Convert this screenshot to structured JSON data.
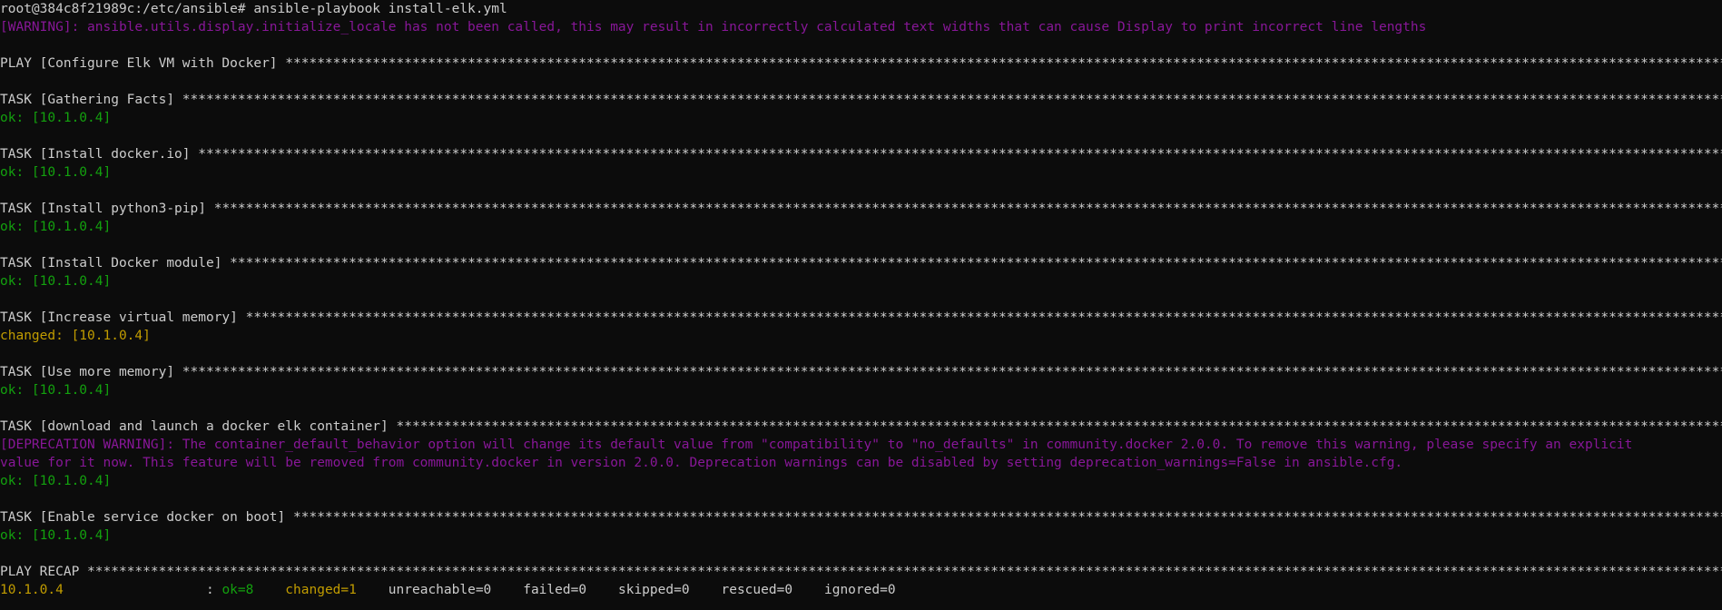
{
  "terminal": {
    "prompt": "root@384c8f21989c:/etc/ansible#",
    "command": "ansible-playbook install-elk.yml",
    "warning": "[WARNING]: ansible.utils.display.initialize_locale has not been called, this may result in incorrectly calculated text widths that can cause Display to print incorrect line lengths",
    "stars": "*****************************************************************************************************************************************************************************************************************************************************",
    "play_header": "PLAY [Configure Elk VM with Docker]",
    "tasks": [
      {
        "header": "TASK [Gathering Facts]",
        "status": "ok: [10.1.0.4]",
        "color": "#13a10e"
      },
      {
        "header": "TASK [Install docker.io]",
        "status": "ok: [10.1.0.4]",
        "color": "#13a10e"
      },
      {
        "header": "TASK [Install python3-pip]",
        "status": "ok: [10.1.0.4]",
        "color": "#13a10e"
      },
      {
        "header": "TASK [Install Docker module]",
        "status": "ok: [10.1.0.4]",
        "color": "#13a10e"
      },
      {
        "header": "TASK [Increase virtual memory]",
        "status": "changed: [10.1.0.4]",
        "color": "#c19c00"
      },
      {
        "header": "TASK [Use more memory]",
        "status": "ok: [10.1.0.4]",
        "color": "#13a10e"
      },
      {
        "header": "TASK [download and launch a docker elk container]",
        "deprecation_line1": "[DEPRECATION WARNING]: The container_default_behavior option will change its default value from \"compatibility\" to \"no_defaults\" in community.docker 2.0.0. To remove this warning, please specify an explicit",
        "deprecation_line2": "value for it now. This feature will be removed from community.docker in version 2.0.0. Deprecation warnings can be disabled by setting deprecation_warnings=False in ansible.cfg.",
        "status": "ok: [10.1.0.4]",
        "color": "#13a10e"
      },
      {
        "header": "TASK [Enable service docker on boot]",
        "status": "ok: [10.1.0.4]",
        "color": "#13a10e"
      }
    ],
    "recap_header": "PLAY RECAP",
    "recap": {
      "host": "10.1.0.4",
      "sep": ":",
      "ok": "ok=8",
      "changed": "changed=1",
      "unreachable": "unreachable=0",
      "failed": "failed=0",
      "skipped": "skipped=0",
      "rescued": "rescued=0",
      "ignored": "ignored=0"
    },
    "colors": {
      "background": "#0c0c0c",
      "foreground": "#cccccc",
      "ok": "#13a10e",
      "changed": "#c19c00",
      "warning": "#881798"
    }
  }
}
